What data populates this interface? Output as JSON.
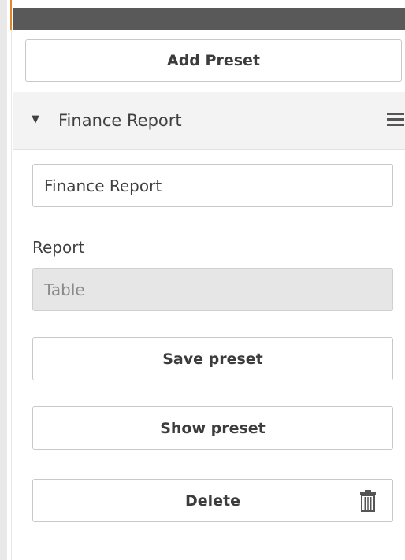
{
  "toolbar": {
    "add_preset_label": "Add Preset"
  },
  "preset": {
    "title": "Finance Report",
    "name_value": "Finance Report",
    "report_label": "Report",
    "report_value": "Table",
    "save_label": "Save preset",
    "show_label": "Show preset",
    "delete_label": "Delete"
  },
  "icons": {
    "caret": "caret-down-icon",
    "menu": "hamburger-menu-icon",
    "delete": "trash-icon"
  },
  "colors": {
    "accent": "#e3862e",
    "top_bar": "#595959",
    "header_bg": "#f3f3f3",
    "disabled_field_bg": "#e6e6e6"
  }
}
